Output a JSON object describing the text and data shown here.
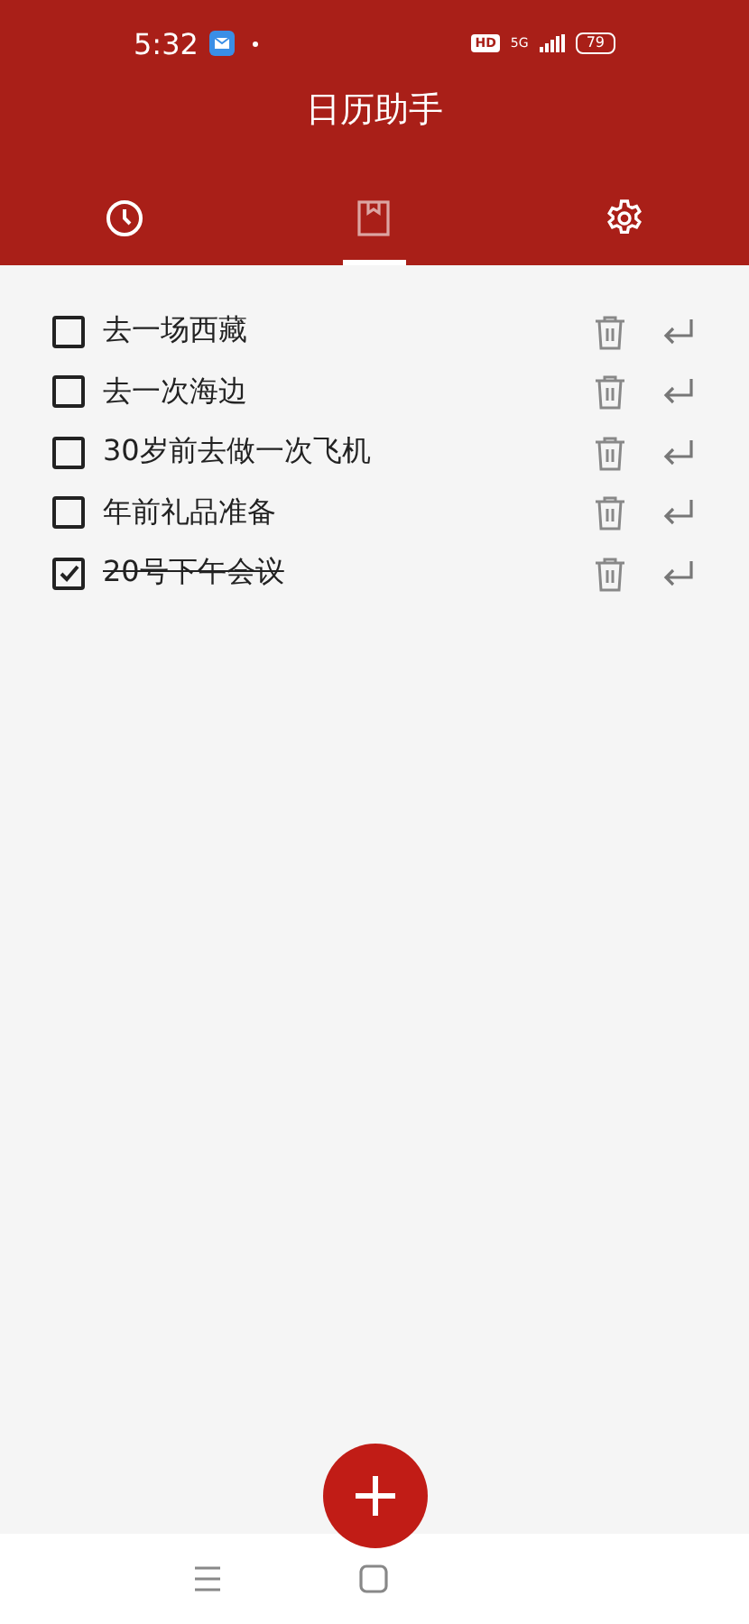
{
  "status_bar": {
    "time": "5:32",
    "hd_badge": "HD",
    "network": "5G",
    "battery": "79"
  },
  "title": "日历助手",
  "tabs": [
    {
      "kind": "clock",
      "selected": false
    },
    {
      "kind": "bookmark",
      "selected": true
    },
    {
      "kind": "settings",
      "selected": false
    }
  ],
  "todos": [
    {
      "text": "去一场西藏",
      "checked": false
    },
    {
      "text": "去一次海边",
      "checked": false
    },
    {
      "text": "30岁前去做一次飞机",
      "checked": false
    },
    {
      "text": "年前礼品准备",
      "checked": false
    },
    {
      "text": "20号下午会议",
      "checked": true
    }
  ]
}
